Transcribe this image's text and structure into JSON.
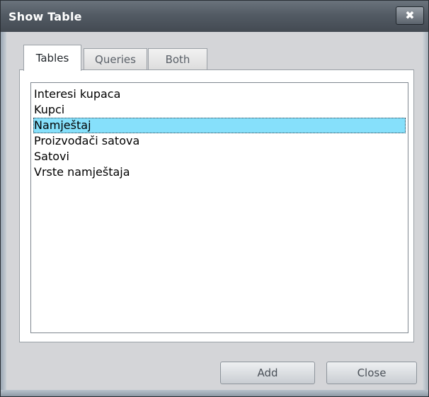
{
  "window": {
    "title": "Show Table",
    "close_glyph": "✖"
  },
  "tabs": [
    {
      "label": "Tables",
      "active": true
    },
    {
      "label": "Queries",
      "active": false
    },
    {
      "label": "Both",
      "active": false
    }
  ],
  "list": {
    "items": [
      {
        "label": "Interesi kupaca",
        "selected": false
      },
      {
        "label": "Kupci",
        "selected": false
      },
      {
        "label": "Namještaj",
        "selected": true
      },
      {
        "label": "Proizvođači satova",
        "selected": false
      },
      {
        "label": "Satovi",
        "selected": false
      },
      {
        "label": "Vrste namještaja",
        "selected": false
      }
    ]
  },
  "buttons": {
    "add_label": "Add",
    "close_label": "Close"
  },
  "colors": {
    "selection": "#86e0fb",
    "titlebar": "#535b64",
    "dialog_body": "#d4d5d8"
  }
}
